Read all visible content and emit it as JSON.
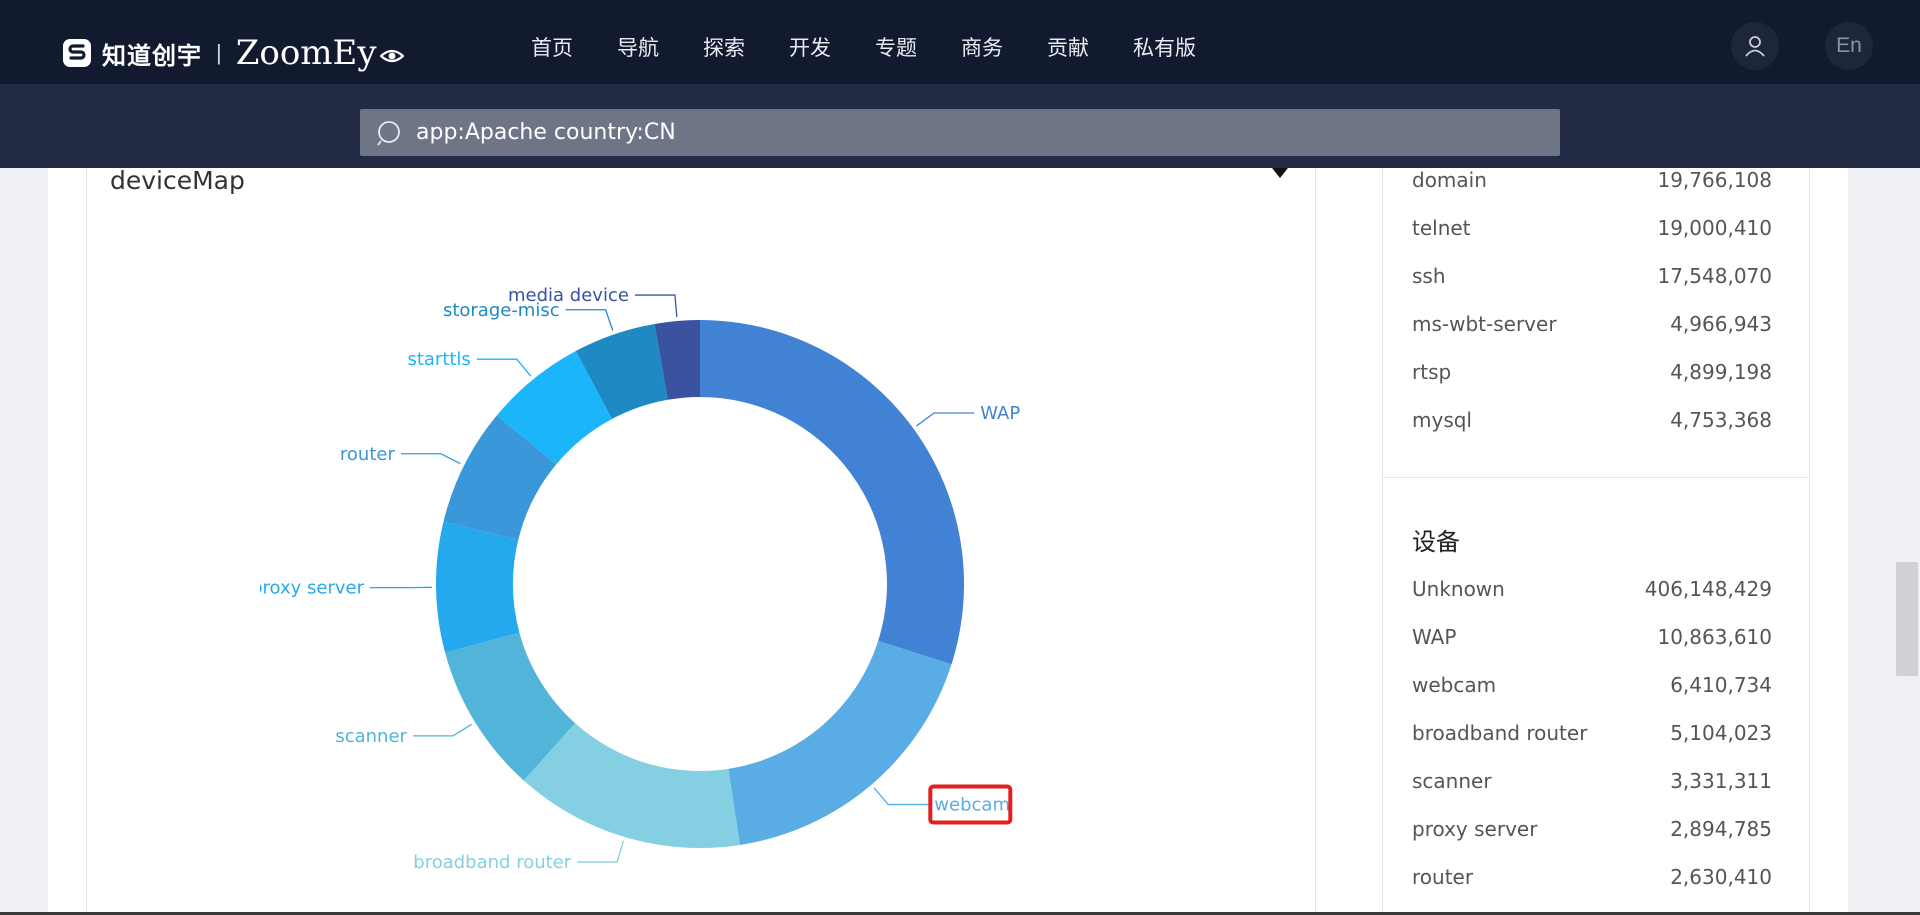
{
  "brand": {
    "cn": "知道创宇",
    "sep": "|",
    "en": "ZoomEy"
  },
  "nav": [
    "首页",
    "导航",
    "探索",
    "开发",
    "专题",
    "商务",
    "贡献",
    "私有版"
  ],
  "lang": "En",
  "search": {
    "value": "app:Apache country:CN"
  },
  "panel": {
    "title": "deviceMap"
  },
  "chart_data": {
    "type": "pie",
    "donut": true,
    "title": "",
    "slices": [
      {
        "label": "WAP",
        "value": 10863610,
        "color": "#4282d4"
      },
      {
        "label": "webcam",
        "value": 6410734,
        "color": "#5aace4"
      },
      {
        "label": "broadband router",
        "value": 5104023,
        "color": "#84d0e2"
      },
      {
        "label": "scanner",
        "value": 3331311,
        "color": "#52b4d8"
      },
      {
        "label": "proxy server",
        "value": 2894785,
        "color": "#25a9ee"
      },
      {
        "label": "router",
        "value": 2630410,
        "color": "#3a98da"
      },
      {
        "label": "starttls",
        "value": 2240000,
        "color": "#1bb5fa"
      },
      {
        "label": "storage-misc",
        "value": 1830000,
        "color": "#1f89c4"
      },
      {
        "label": "media device",
        "value": 1000000,
        "color": "#3a52a0"
      }
    ]
  },
  "sidebar": {
    "services": [
      {
        "name": "domain",
        "count": "19,766,108"
      },
      {
        "name": "telnet",
        "count": "19,000,410"
      },
      {
        "name": "ssh",
        "count": "17,548,070"
      },
      {
        "name": "ms-wbt-server",
        "count": "4,966,943"
      },
      {
        "name": "rtsp",
        "count": "4,899,198"
      },
      {
        "name": "mysql",
        "count": "4,753,368"
      }
    ],
    "devices_title": "设备",
    "devices": [
      {
        "name": "Unknown",
        "count": "406,148,429"
      },
      {
        "name": "WAP",
        "count": "10,863,610"
      },
      {
        "name": "webcam",
        "count": "6,410,734"
      },
      {
        "name": "broadband router",
        "count": "5,104,023"
      },
      {
        "name": "scanner",
        "count": "3,331,311"
      },
      {
        "name": "proxy server",
        "count": "2,894,785"
      },
      {
        "name": "router",
        "count": "2,630,410"
      }
    ]
  }
}
